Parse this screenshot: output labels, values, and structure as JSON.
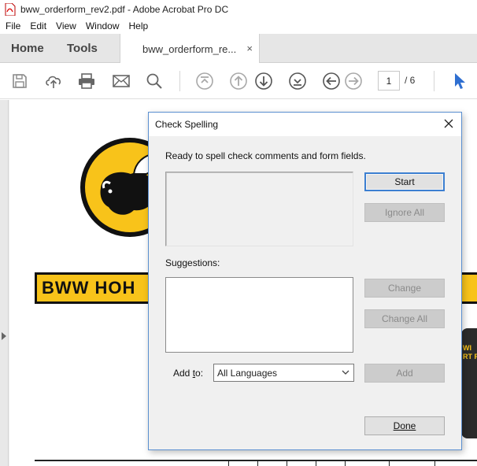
{
  "window": {
    "title": "bww_orderform_rev2.pdf - Adobe Acrobat Pro DC"
  },
  "menu": {
    "items": [
      "File",
      "Edit",
      "View",
      "Window",
      "Help"
    ]
  },
  "tabs": {
    "home": "Home",
    "tools": "Tools",
    "document": "bww_orderform_re...",
    "close": "×"
  },
  "toolbar": {
    "icons": [
      "save-icon",
      "upload-icon",
      "print-icon",
      "email-icon",
      "search-icon",
      "first-page-icon",
      "prev-page-icon",
      "next-page-icon",
      "last-page-icon",
      "back-icon",
      "forward-icon",
      "select-cursor-icon"
    ],
    "page_current": "1",
    "page_total": "/ 6",
    "accent": "#2f6fd1"
  },
  "document": {
    "banner_text": "BWW HOH",
    "shirt_text": "WI\nRT F",
    "brand_yellow": "#f8c31a"
  },
  "dialog": {
    "title": "Check Spelling",
    "status": "Ready to spell check comments and form fields.",
    "suggestions_label": "Suggestions:",
    "add_to_label_prefix": "Add ",
    "add_to_label_access": "t",
    "add_to_label_suffix": "o:",
    "language": "All Languages",
    "buttons": {
      "start": "Start",
      "ignore_all": "Ignore All",
      "change": "Change",
      "change_all": "Change All",
      "add": "Add",
      "done": "Done"
    }
  }
}
